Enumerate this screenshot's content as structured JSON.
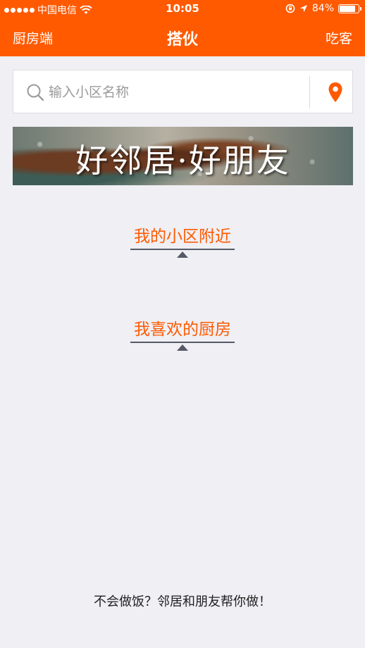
{
  "status_bar": {
    "carrier": "中国电信",
    "time": "10:05",
    "battery": "84%",
    "battery_level": 0.84
  },
  "nav": {
    "left_label": "厨房端",
    "title": "搭伙",
    "right_label": "吃客"
  },
  "search": {
    "placeholder": "输入小区名称",
    "value": ""
  },
  "banner": {
    "text": "好邻居·好朋友"
  },
  "sections": [
    {
      "label": "我的小区附近"
    },
    {
      "label": "我喜欢的厨房"
    }
  ],
  "footer": {
    "text": "不会做饭？邻居和朋友帮你做！"
  },
  "colors": {
    "brand": "#ff5a00",
    "background": "#efeff4"
  }
}
